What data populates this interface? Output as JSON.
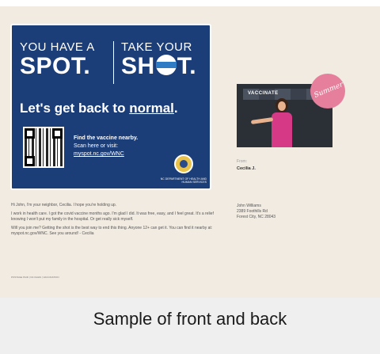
{
  "front": {
    "left_small": "YOU HAVE A",
    "left_big": "SPOT.",
    "right_small": "TAKE YOUR",
    "right_big_a": "SH",
    "right_big_b": "T.",
    "getback_a": "Let's get back to ",
    "getback_b": "normal",
    "getback_c": ".",
    "find_title": "Find the vaccine nearby.",
    "find_line": "Scan here or visit:",
    "find_url": "myspot.nc.gov/WNC",
    "seal_caption": "NC DEPARTMENT OF HEALTH AND HUMAN SERVICES"
  },
  "letter": {
    "p1": "Hi John, I'm your neighbor, Cecilia. I hope you're holding up.",
    "p2": "I work in health care. I got the covid vaccine months ago. I'm glad I did. It was free, easy, and I feel great. It's a relief knowing I won't put my family in the hospital. Or get really sick myself.",
    "p3": "Will you join me? Getting the shot is the best way to end this thing. Anyone 12+ can get it. You can find it nearby at: myspot.nc.gov/WNC. See you around! - Cecilia",
    "footnote": "POSTAGE PAID | NC DHHS | VACCINATION"
  },
  "back": {
    "photo_banner": "VACCINATE",
    "sticker": "Summer",
    "from_label": "From:",
    "from_name": "Cecilia J.",
    "addr1": "John Williams",
    "addr2": "2389 Foothills Rd",
    "addr3": "Forest City, NC 28043"
  },
  "caption": "Sample of front and back"
}
